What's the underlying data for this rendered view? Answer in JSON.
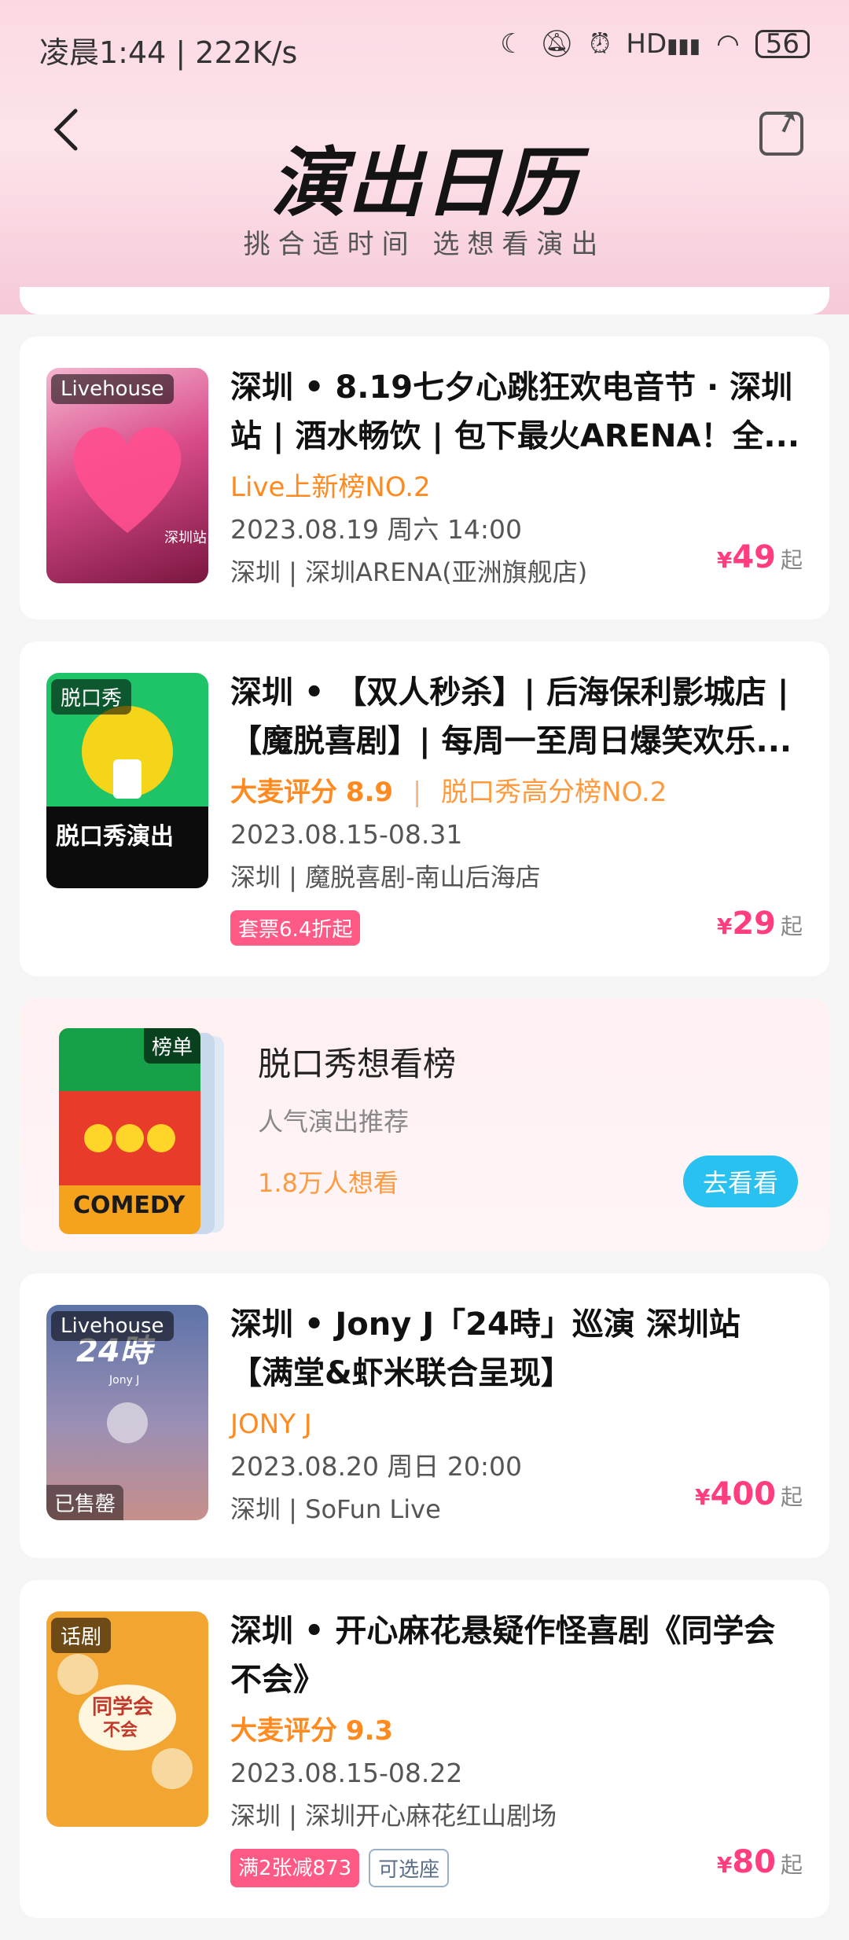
{
  "status": {
    "time": "凌晨1:44 | 222K/s",
    "battery": "56",
    "hd": "HD"
  },
  "header": {
    "title": "演出日历",
    "subtitle": "挑合适时间 选想看演出"
  },
  "cards": [
    {
      "poster_tag": "Livehouse",
      "title": "深圳 • 8.19七夕心跳狂欢电音节 · 深圳站 | 酒水畅饮 | 包下最火ARENA！全...",
      "meta": "Live上新榜NO.2",
      "date": "2023.08.19 周六 14:00",
      "venue": "深圳 | 深圳ARENA(亚洲旗舰店)",
      "price": "49",
      "currency": "¥",
      "price_suffix": "起"
    },
    {
      "poster_tag": "脱口秀",
      "title": "深圳 • 【双人秒杀】| 后海保利影城店 | 【魔脱喜剧】| 每周一至周日爆笑欢乐...",
      "score_label": "大麦评分",
      "score": "8.9",
      "rank": "脱口秀高分榜NO.2",
      "date": "2023.08.15-08.31",
      "venue": "深圳 | 魔脱喜剧-南山后海店",
      "badge": "套票6.4折起",
      "price": "29",
      "currency": "¥",
      "price_suffix": "起"
    },
    {
      "poster_tag": "Livehouse",
      "sold_tag": "已售罄",
      "title": "深圳 • Jony J「24時」巡演 深圳站【满堂&虾米联合呈现】",
      "meta": "JONY J",
      "date": "2023.08.20 周日 20:00",
      "venue": "深圳 | SoFun Live",
      "price": "400",
      "currency": "¥",
      "price_suffix": "起"
    },
    {
      "poster_tag": "话剧",
      "title": "深圳 • 开心麻花悬疑作怪喜剧《同学会不会》",
      "score_label": "大麦评分",
      "score": "9.3",
      "date": "2023.08.15-08.22",
      "venue": "深圳 | 深圳开心麻花红山剧场",
      "badge": "满2张减873",
      "badge2": "可选座",
      "price": "80",
      "currency": "¥",
      "price_suffix": "起"
    }
  ],
  "ranking": {
    "tag": "榜单",
    "title": "脱口秀想看榜",
    "desc": "人气演出推荐",
    "want": "1.8万人想看",
    "button": "去看看"
  },
  "colors": {
    "accent_pink": "#ff3d7f",
    "orange": "#ff8a1f",
    "blue_btn": "#28c1f0"
  }
}
